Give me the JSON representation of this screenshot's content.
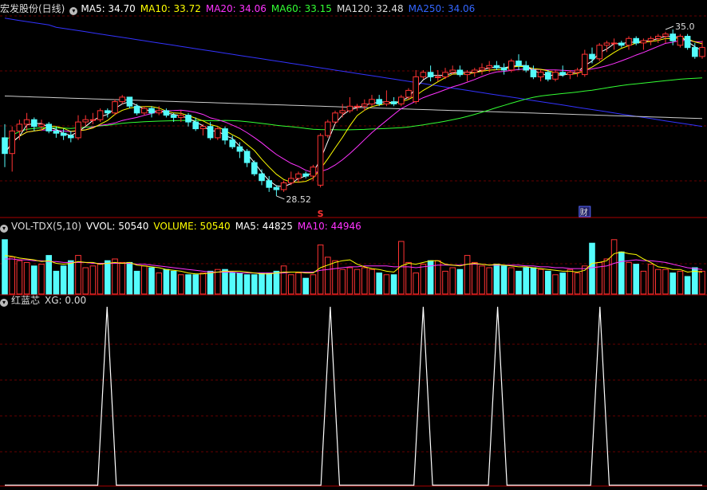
{
  "main_header": {
    "title": "宏发股份(日线)",
    "ma5": "MA5: 34.70",
    "ma10": "MA10: 33.72",
    "ma20": "MA20: 34.06",
    "ma60": "MA60: 33.15",
    "ma120": "MA120: 32.48",
    "ma250": "MA250: 34.06"
  },
  "vol_header": {
    "name": "VOL-TDX(5,10)",
    "vvol": "VVOL: 50540",
    "volume": "VOLUME: 50540",
    "ma5": "MA5: 44825",
    "ma10": "MA10: 44946"
  },
  "ind_header": {
    "name": "红蓝芯",
    "xg": "XG: 0.00"
  },
  "colors": {
    "up": "#ff3333",
    "down": "#54fcfc",
    "ma5": "#ffffff",
    "ma10": "#ffff00",
    "ma20": "#ff33ff",
    "ma60": "#33ff33",
    "ma120": "#cccccc",
    "ma250": "#3333ff"
  },
  "chart_data": [
    {
      "type": "candlestick",
      "title": "宏发股份(日线)",
      "ylim": [
        27.6,
        36.5
      ],
      "annotations": {
        "low_label": "28.52",
        "high_label": "35.0",
        "signal_s": "S",
        "finance_mark": "财"
      },
      "ohlc": [
        [
          31.1,
          31.7,
          29.8,
          30.4
        ],
        [
          30.4,
          31.6,
          29.6,
          31.4
        ],
        [
          31.4,
          31.9,
          31.0,
          31.7
        ],
        [
          31.7,
          32.2,
          31.4,
          31.9
        ],
        [
          31.9,
          32.0,
          31.4,
          31.6
        ],
        [
          31.6,
          31.9,
          31.4,
          31.7
        ],
        [
          31.7,
          31.8,
          31.3,
          31.4
        ],
        [
          31.4,
          31.6,
          31.1,
          31.3
        ],
        [
          31.3,
          31.5,
          31.0,
          31.2
        ],
        [
          31.2,
          31.4,
          30.9,
          31.1
        ],
        [
          31.1,
          32.1,
          31.0,
          31.8
        ],
        [
          31.8,
          32.1,
          31.6,
          31.9
        ],
        [
          31.9,
          32.2,
          31.7,
          31.9
        ],
        [
          31.9,
          32.4,
          31.8,
          32.3
        ],
        [
          32.3,
          32.4,
          32.0,
          32.2
        ],
        [
          32.2,
          32.8,
          32.1,
          32.7
        ],
        [
          32.7,
          33.0,
          32.6,
          32.9
        ],
        [
          32.9,
          32.9,
          32.4,
          32.5
        ],
        [
          32.5,
          32.6,
          32.1,
          32.2
        ],
        [
          32.2,
          32.5,
          32.1,
          32.4
        ],
        [
          32.4,
          32.5,
          32.0,
          32.2
        ],
        [
          32.2,
          32.5,
          32.1,
          32.3
        ],
        [
          32.3,
          32.4,
          32.0,
          32.1
        ],
        [
          32.1,
          32.2,
          31.8,
          32.0
        ],
        [
          32.0,
          32.3,
          31.8,
          32.1
        ],
        [
          32.1,
          32.2,
          31.6,
          31.8
        ],
        [
          31.8,
          32.0,
          31.4,
          31.5
        ],
        [
          31.5,
          31.7,
          31.2,
          31.6
        ],
        [
          31.6,
          31.8,
          31.0,
          31.1
        ],
        [
          31.1,
          31.6,
          31.0,
          31.5
        ],
        [
          31.5,
          31.6,
          30.8,
          31.0
        ],
        [
          31.0,
          31.2,
          30.6,
          30.7
        ],
        [
          30.7,
          30.9,
          30.2,
          30.5
        ],
        [
          30.5,
          30.6,
          29.8,
          30.0
        ],
        [
          30.0,
          30.1,
          29.4,
          29.5
        ],
        [
          29.5,
          29.7,
          29.0,
          29.2
        ],
        [
          29.2,
          29.4,
          28.7,
          28.9
        ],
        [
          28.9,
          29.0,
          28.52,
          28.8
        ],
        [
          28.8,
          29.2,
          28.7,
          29.1
        ],
        [
          29.1,
          29.6,
          29.0,
          29.3
        ],
        [
          29.3,
          29.6,
          29.1,
          29.5
        ],
        [
          29.5,
          29.6,
          29.3,
          29.4
        ],
        [
          29.4,
          29.9,
          29.2,
          29.8
        ],
        [
          29.0,
          31.3,
          28.9,
          31.2
        ],
        [
          31.2,
          31.9,
          31.1,
          31.8
        ],
        [
          31.8,
          32.3,
          31.7,
          32.2
        ],
        [
          32.2,
          32.6,
          32.0,
          32.3
        ],
        [
          32.3,
          32.9,
          32.2,
          32.5
        ],
        [
          32.5,
          32.6,
          32.3,
          32.5
        ],
        [
          32.5,
          32.8,
          32.3,
          32.6
        ],
        [
          32.6,
          33.0,
          32.5,
          32.8
        ],
        [
          32.8,
          33.0,
          32.5,
          32.6
        ],
        [
          32.6,
          33.2,
          32.5,
          32.7
        ],
        [
          32.7,
          32.9,
          32.5,
          32.6
        ],
        [
          32.6,
          33.0,
          32.5,
          32.9
        ],
        [
          32.9,
          33.3,
          32.8,
          33.2
        ],
        [
          32.7,
          34.1,
          32.6,
          33.8
        ],
        [
          33.8,
          34.1,
          33.7,
          34.0
        ],
        [
          34.0,
          34.3,
          33.6,
          33.8
        ],
        [
          33.8,
          34.1,
          33.6,
          33.8
        ],
        [
          33.8,
          34.2,
          33.7,
          34.0
        ],
        [
          34.0,
          34.3,
          33.9,
          34.1
        ],
        [
          34.1,
          34.3,
          33.8,
          33.9
        ],
        [
          33.9,
          34.1,
          33.6,
          34.0
        ],
        [
          34.0,
          34.2,
          33.8,
          34.1
        ],
        [
          34.1,
          34.4,
          33.9,
          34.2
        ],
        [
          34.2,
          34.5,
          34.0,
          34.3
        ],
        [
          34.3,
          34.5,
          34.1,
          34.2
        ],
        [
          34.2,
          34.4,
          33.9,
          34.1
        ],
        [
          34.1,
          34.6,
          34.0,
          34.5
        ],
        [
          34.5,
          34.8,
          34.1,
          34.3
        ],
        [
          34.3,
          34.5,
          34.0,
          34.1
        ],
        [
          34.1,
          34.3,
          33.7,
          33.8
        ],
        [
          33.8,
          34.1,
          33.6,
          34.0
        ],
        [
          34.0,
          34.1,
          33.6,
          33.7
        ],
        [
          33.7,
          34.1,
          33.6,
          34.0
        ],
        [
          34.0,
          34.3,
          33.8,
          33.9
        ],
        [
          33.9,
          34.1,
          33.7,
          34.0
        ],
        [
          34.0,
          34.2,
          33.8,
          34.1
        ],
        [
          33.9,
          35.0,
          33.8,
          34.8
        ],
        [
          34.8,
          35.1,
          34.4,
          34.6
        ],
        [
          34.6,
          35.3,
          34.5,
          35.2
        ],
        [
          35.2,
          35.4,
          34.9,
          35.3
        ],
        [
          35.3,
          35.5,
          35.0,
          35.3
        ],
        [
          35.3,
          35.4,
          35.1,
          35.2
        ],
        [
          35.2,
          35.6,
          35.0,
          35.5
        ],
        [
          35.5,
          35.6,
          35.2,
          35.3
        ],
        [
          35.3,
          35.5,
          35.0,
          35.4
        ],
        [
          35.4,
          35.6,
          35.2,
          35.5
        ],
        [
          35.5,
          35.7,
          35.3,
          35.6
        ],
        [
          35.6,
          35.8,
          35.3,
          35.7
        ],
        [
          35.7,
          35.9,
          35.2,
          35.4
        ],
        [
          35.2,
          35.7,
          35.1,
          35.6
        ],
        [
          35.6,
          35.7,
          35.0,
          35.1
        ],
        [
          35.1,
          35.3,
          34.6,
          34.7
        ],
        [
          34.7,
          35.4,
          34.6,
          35.1
        ]
      ],
      "ma_lines": {
        "ma250": [
          36.4,
          36.35,
          36.3,
          36.25,
          36.2,
          36.15,
          36.1,
          36.0,
          35.95,
          35.9,
          35.85,
          35.8,
          35.75,
          35.7,
          35.65,
          35.6,
          35.55,
          35.5,
          35.45,
          35.4,
          35.35,
          35.3,
          35.25,
          35.2,
          35.15,
          35.1,
          35.05,
          35.0,
          34.95,
          34.9,
          34.85,
          34.8,
          34.75,
          34.7,
          34.65,
          34.6,
          34.55,
          34.5,
          34.45,
          34.4,
          34.35,
          34.3,
          34.25,
          34.2,
          34.15,
          34.1,
          34.05,
          34.0,
          33.95,
          33.9,
          33.85,
          33.8,
          33.75,
          33.7,
          33.65,
          33.6,
          33.55,
          33.5,
          33.45,
          33.4,
          33.35,
          33.3,
          33.25,
          33.2,
          33.15,
          33.1,
          33.05,
          33.0,
          32.95,
          32.9,
          32.85,
          32.8,
          32.75,
          32.7,
          32.65,
          32.6,
          32.55,
          32.5,
          32.45,
          32.4,
          32.35,
          32.3,
          32.25,
          32.2,
          32.15,
          32.1,
          32.05,
          32.0,
          31.95,
          31.9,
          31.85,
          31.8,
          31.75,
          31.7,
          31.65,
          31.6
        ]
      }
    },
    {
      "type": "bar",
      "title": "VOL-TDX(5,10)",
      "ylim": [
        0,
        70000
      ],
      "values": [
        62000,
        42000,
        38000,
        36000,
        32000,
        34000,
        44000,
        26000,
        32000,
        38000,
        44000,
        30000,
        32000,
        34000,
        38000,
        40000,
        36000,
        36000,
        26000,
        32000,
        30000,
        24000,
        28000,
        26000,
        22000,
        22000,
        22000,
        24000,
        26000,
        28000,
        28000,
        24000,
        24000,
        22000,
        22000,
        24000,
        24000,
        26000,
        32000,
        22000,
        24000,
        18000,
        22000,
        56000,
        42000,
        38000,
        28000,
        30000,
        28000,
        30000,
        28000,
        24000,
        22000,
        22000,
        60000,
        36000,
        24000,
        34000,
        38000,
        38000,
        26000,
        30000,
        28000,
        44000,
        36000,
        32000,
        30000,
        34000,
        32000,
        30000,
        26000,
        30000,
        30000,
        28000,
        26000,
        22000,
        24000,
        28000,
        24000,
        32000,
        58000,
        36000,
        40000,
        62000,
        48000,
        36000,
        34000,
        26000,
        34000,
        28000,
        28000,
        24000,
        26000,
        20000,
        30000,
        26000
      ],
      "ma5": [
        44000,
        43000,
        41000,
        40000,
        39000,
        37000,
        38000,
        35000,
        34000,
        35000,
        37000,
        36000,
        36000,
        34000,
        35000,
        36000,
        35000,
        36000,
        33000,
        32000,
        31000,
        30000,
        28000,
        27000,
        26000,
        24000,
        23000,
        23000,
        24000,
        25000,
        26000,
        26000,
        26000,
        25000,
        24000,
        23000,
        23000,
        24000,
        25000,
        25000,
        25000,
        24000,
        24000,
        30000,
        33000,
        36000,
        38000,
        39000,
        34000,
        31000,
        29000,
        28000,
        26000,
        25000,
        32000,
        35000,
        34000,
        36000,
        38000,
        38000,
        34000,
        33000,
        32000,
        34000,
        35000,
        34000,
        33000,
        34000,
        33000,
        32000,
        31000,
        31000,
        30000,
        29000,
        28000,
        27000,
        26000,
        26000,
        25000,
        27000,
        35000,
        36000,
        38000,
        46000,
        48000,
        46000,
        45000,
        40000,
        36000,
        31000,
        30000,
        28000,
        28000,
        25000,
        26000,
        25000
      ],
      "ma10": [
        40000,
        40000,
        39000,
        39000,
        38000,
        38000,
        37000,
        37000,
        36000,
        36000,
        36000,
        36000,
        35000,
        35000,
        35000,
        35000,
        35000,
        35000,
        34000,
        34000,
        33000,
        32000,
        31000,
        30000,
        29000,
        28000,
        27000,
        26000,
        25000,
        25000,
        25000,
        25000,
        24000,
        24000,
        24000,
        24000,
        24000,
        24000,
        24000,
        25000,
        25000,
        25000,
        25000,
        27000,
        28000,
        29000,
        30000,
        31000,
        31000,
        32000,
        32000,
        32000,
        32000,
        31000,
        31000,
        31000,
        30000,
        31000,
        32000,
        33000,
        33000,
        33000,
        33000,
        34000,
        34000,
        34000,
        33000,
        33000,
        33000,
        33000,
        33000,
        32000,
        32000,
        31000,
        31000,
        30000,
        30000,
        29000,
        29000,
        29000,
        30000,
        31000,
        32000,
        35000,
        37000,
        38000,
        39000,
        38000,
        38000,
        37000,
        36000,
        34000,
        32000,
        30000,
        29000,
        28000
      ]
    },
    {
      "type": "line",
      "title": "红蓝芯",
      "ylim": [
        0,
        1
      ],
      "spikes": [
        11,
        35,
        45,
        53,
        64
      ],
      "values": [
        0,
        0,
        0,
        0,
        0,
        0,
        0,
        0,
        0,
        0,
        0,
        1,
        0,
        0,
        0,
        0,
        0,
        0,
        0,
        0,
        0,
        0,
        0,
        0,
        0,
        0,
        0,
        0,
        0,
        0,
        0,
        0,
        0,
        0,
        0,
        1,
        0,
        0,
        0,
        0,
        0,
        0,
        0,
        0,
        0,
        1,
        0,
        0,
        0,
        0,
        0,
        0,
        0,
        1,
        0,
        0,
        0,
        0,
        0,
        0,
        0,
        0,
        0,
        0,
        1,
        0,
        0,
        0,
        0,
        0,
        0,
        0,
        0,
        0,
        0,
        0
      ]
    }
  ]
}
